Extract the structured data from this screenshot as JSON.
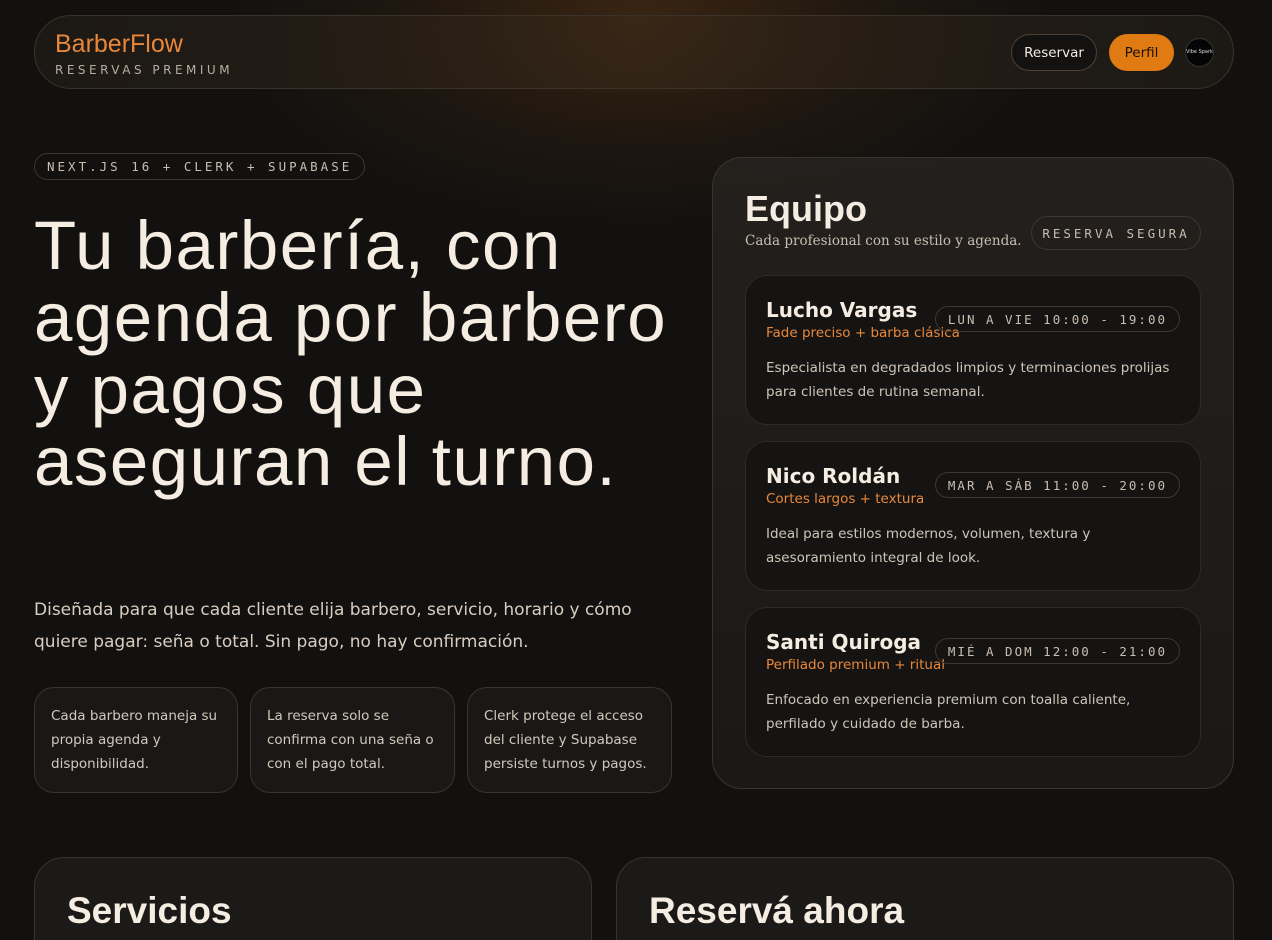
{
  "nav": {
    "brand": "BarberFlow",
    "tagline": "RESERVAS PREMIUM",
    "reservar_label": "Reservar",
    "perfil_label": "Perfil",
    "avatar_text": "Vibe Spark"
  },
  "hero": {
    "badge": "NEXT.JS 16 + CLERK + SUPABASE",
    "title": "Tu barbería, con agenda por barbero y pagos que aseguran el turno.",
    "description": "Diseñada para que cada cliente elija barbero, servicio, horario y cómo quiere pagar: seña o total. Sin pago, no hay confirmación.",
    "features": [
      "Cada barbero maneja su propia agenda y disponibilidad.",
      "La reserva solo se confirma con una seña o con el pago total.",
      "Clerk protege el acceso del cliente y Supabase persiste turnos y pagos."
    ]
  },
  "team": {
    "title": "Equipo",
    "subtitle": "Cada profesional con su estilo y agenda.",
    "badge": "RESERVA SEGURA",
    "barbers": [
      {
        "name": "Lucho Vargas",
        "specialty": "Fade preciso + barba clásica",
        "hours": "LUN A VIE 10:00 - 19:00",
        "description": "Especialista en degradados limpios y terminaciones prolijas para clientes de rutina semanal."
      },
      {
        "name": "Nico Roldán",
        "specialty": "Cortes largos + textura",
        "hours": "MAR A SÁB 11:00 - 20:00",
        "description": "Ideal para estilos modernos, volumen, textura y asesoramiento integral de look."
      },
      {
        "name": "Santi Quiroga",
        "specialty": "Perfilado premium + ritual",
        "hours": "MIÉ A DOM 12:00 - 21:00",
        "description": "Enfocado en experiencia premium con toalla caliente, perfilado y cuidado de barba."
      }
    ]
  },
  "sections": {
    "services_title": "Servicios",
    "booking_title": "Reservá ahora"
  },
  "colors": {
    "accent": "#e8873a",
    "button": "#e07b14",
    "background": "#121110"
  }
}
